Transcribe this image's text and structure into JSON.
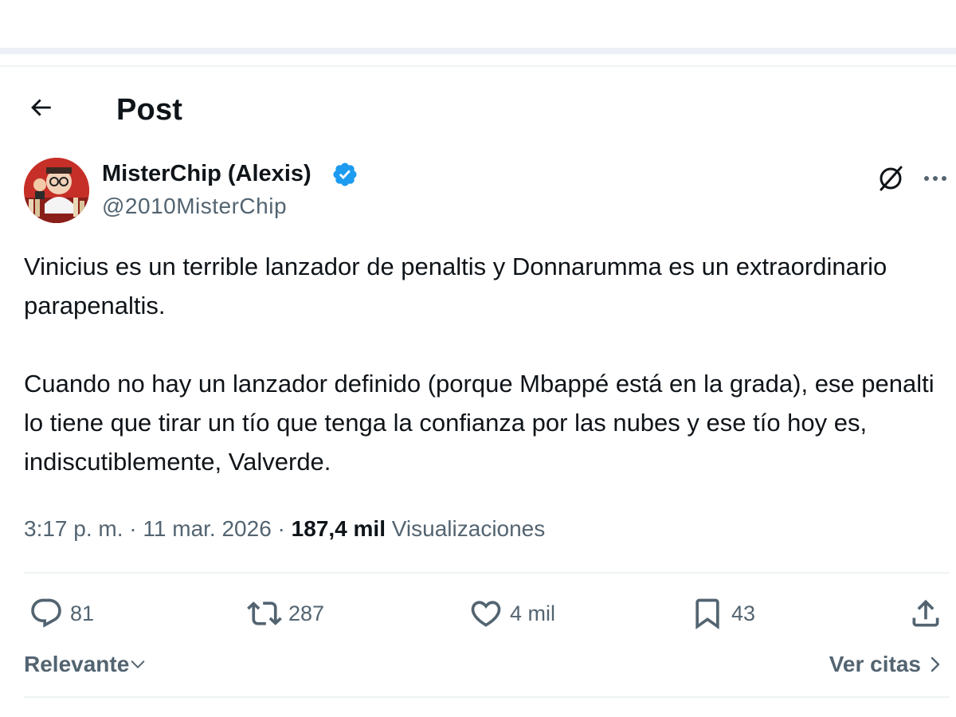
{
  "header": {
    "title": "Post",
    "back_icon": "arrow-left-icon"
  },
  "author": {
    "display_name": "MisterChip (Alexis)",
    "handle": "@2010MisterChip",
    "verified_icon": "verified-badge-icon",
    "verified_color": "#1d9bf0"
  },
  "tweet": {
    "text": "Vinicius es un terrible lanzador de penaltis y Donnarumma es un extraordinario parapenaltis.\n\nCuando no hay un lanzador definido (porque Mbappé está en la grada), ese penalti lo tiene que tirar un tío que tenga la confianza por las nubes y ese tío hoy es, indiscutiblemente, Valverde."
  },
  "meta": {
    "time": "3:17 p. m.",
    "dot1": " · ",
    "date": "11 mar. 2026",
    "dot2": " · ",
    "views_count": "187,4 mil",
    "views_label": " Visualizaciones"
  },
  "actions": {
    "reply_count": "81",
    "retweet_count": "287",
    "like_count": "4 mil",
    "bookmark_count": "43"
  },
  "footer": {
    "sort_label": "Relevante",
    "quotes_label": "Ver citas"
  },
  "colors": {
    "text_primary": "#0f1419",
    "text_secondary": "#536471",
    "accent": "#1d9bf0",
    "divider": "#eff3f4"
  }
}
